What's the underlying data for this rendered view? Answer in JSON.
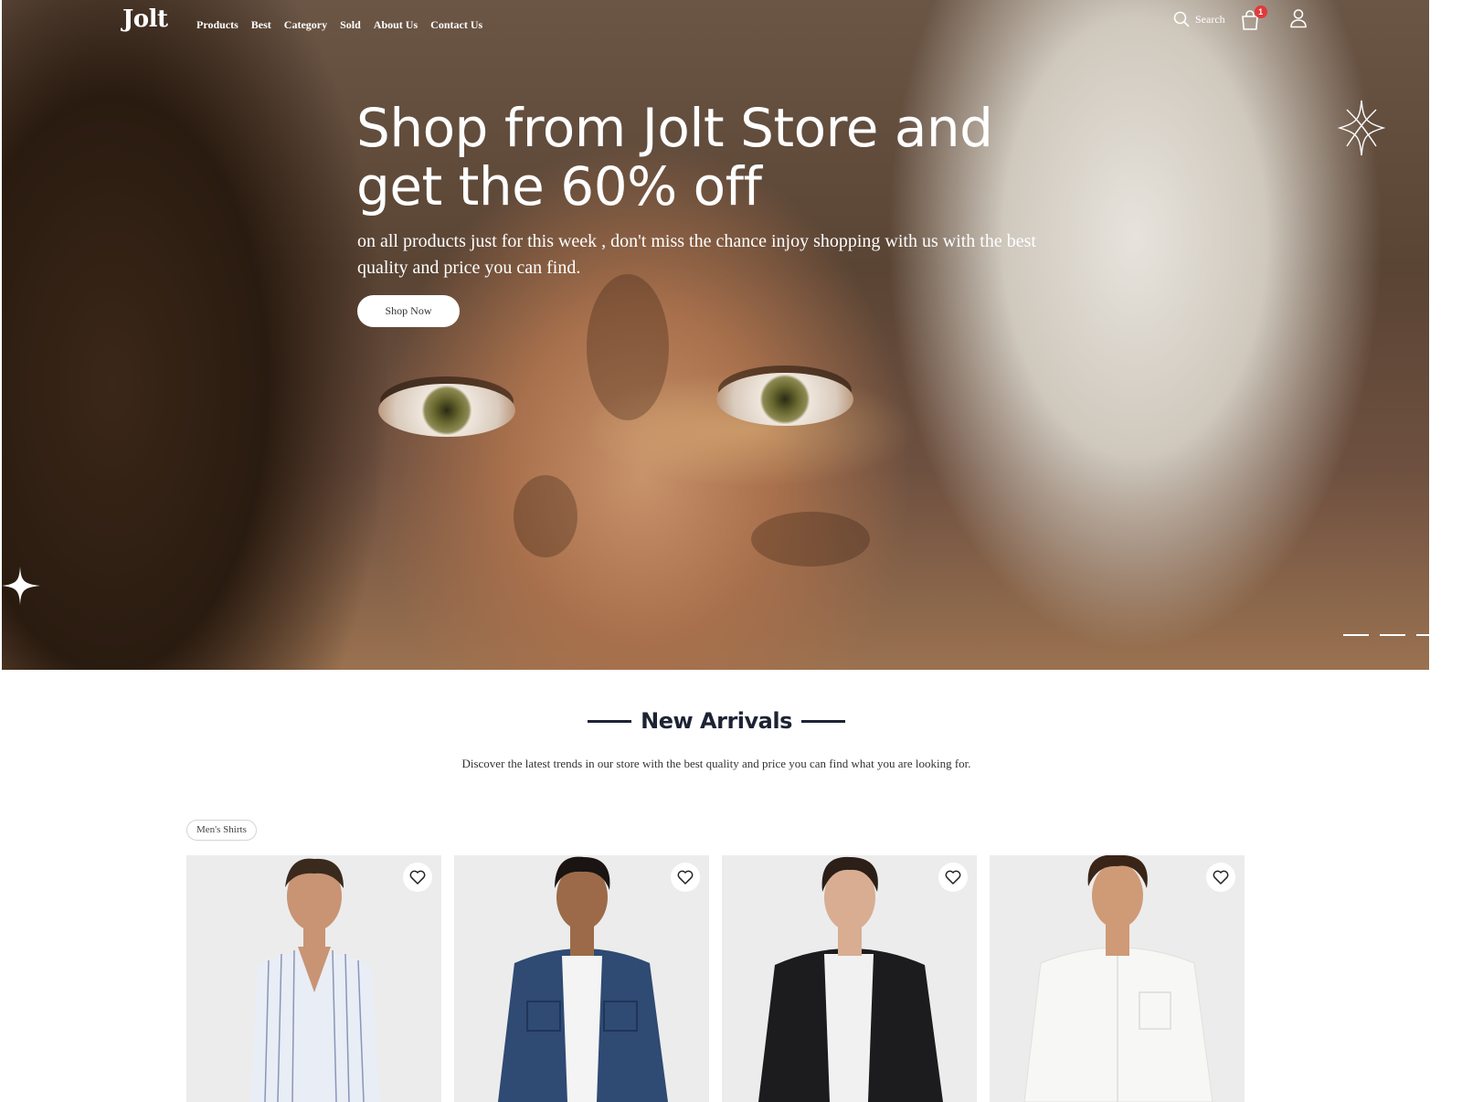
{
  "brand": {
    "logo": "Jolt"
  },
  "nav": {
    "links": [
      "Products",
      "Best",
      "Category",
      "Sold",
      "About Us",
      "Contact Us"
    ],
    "search_label": "Search",
    "cart_count": "1"
  },
  "hero": {
    "title": "Shop from Jolt Store and get the 60% off",
    "subtitle": "on all products just for this week , don't miss the chance injoy shopping with us with the best quality and price you can find.",
    "cta_label": "Shop Now",
    "slides": 3
  },
  "new_arrivals": {
    "title": "New Arrivals",
    "description": "Discover the latest trends in our store with the best quality and price you can find what you are looking for.",
    "filter_tag": "Men's Shirts",
    "products": [
      {
        "name": "striped-shirt",
        "shirt_color": "#e9edf5",
        "stripe_color": "#8a96b8",
        "hair_color": "#3a2a1e",
        "skin_color": "#c89474"
      },
      {
        "name": "denim-jacket",
        "shirt_color": "#2f4a73",
        "stripe_color": "#2f4a73",
        "hair_color": "#1a1412",
        "skin_color": "#9c6a48"
      },
      {
        "name": "black-corduroy-jacket",
        "shirt_color": "#1c1c1e",
        "stripe_color": "#2a2a2c",
        "hair_color": "#2b1f18",
        "skin_color": "#d8ad92"
      },
      {
        "name": "white-shirt",
        "shirt_color": "#f7f7f5",
        "stripe_color": "#f7f7f5",
        "hair_color": "#3a2418",
        "skin_color": "#cf9a76"
      }
    ]
  },
  "colors": {
    "accent": "#1d2333",
    "badge": "#e03a3a",
    "card_bg": "#ececec"
  }
}
